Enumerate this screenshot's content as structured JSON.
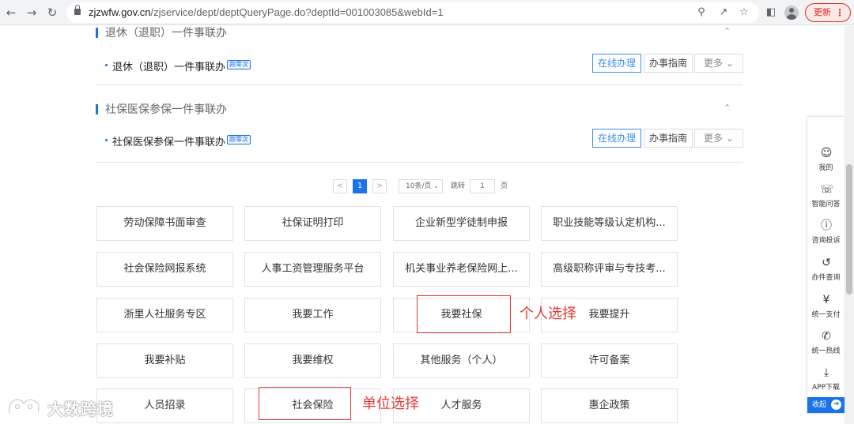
{
  "browser": {
    "url_host": "zjzwfw.gov.cn",
    "url_path": "/zjservice/dept/deptQueryPage.do?deptId=001003085&webId=1",
    "update_label": "更新"
  },
  "sections": [
    {
      "title": "退休（退职）一件事联办",
      "item": "退休（退职）一件事联办",
      "tag": "跑零次",
      "online": "在线办理",
      "guide": "办事指南",
      "more": "更多"
    },
    {
      "title": "社保医保参保一件事联办",
      "item": "社保医保参保一件事联办",
      "tag": "跑零次",
      "online": "在线办理",
      "guide": "办事指南",
      "more": "更多"
    }
  ],
  "pagination": {
    "prev": "<",
    "current": "1",
    "next": ">",
    "page_size": "10条/页",
    "goto_label": "跳转",
    "goto_value": "1",
    "page_suffix": "页"
  },
  "grid": [
    [
      "劳动保障书面审查",
      "社保证明打印",
      "企业新型学徒制申报",
      "职业技能等级认定机构..."
    ],
    [
      "社会保险网报系统",
      "人事工资管理服务平台",
      "机关事业养老保险网上...",
      "高级职称评审与专技考..."
    ],
    [
      "浙里人社服务专区",
      "我要工作",
      "我要社保",
      "我要提升"
    ],
    [
      "我要补贴",
      "我要维权",
      "其他服务（个人）",
      "许可备案"
    ],
    [
      "人员招录",
      "社会保险",
      "人才服务",
      "惠企政策"
    ]
  ],
  "annotations": {
    "personal": "个人选择",
    "company": "单位选择"
  },
  "right_sidebar": {
    "items": [
      {
        "label": "我的",
        "icon": "user-icon"
      },
      {
        "label": "智能问答",
        "icon": "headset-icon"
      },
      {
        "label": "咨询投诉",
        "icon": "shield-icon"
      },
      {
        "label": "办件查询",
        "icon": "history-icon"
      },
      {
        "label": "统一支付",
        "icon": "yen-icon"
      },
      {
        "label": "统一热线",
        "icon": "phone-icon"
      },
      {
        "label": "APP下载",
        "icon": "download-icon"
      }
    ],
    "collapse_label": "收起"
  },
  "watermark": {
    "text": "大数跨境"
  },
  "colors": {
    "accent": "#1a73e8",
    "annotation_red": "#e53935"
  }
}
